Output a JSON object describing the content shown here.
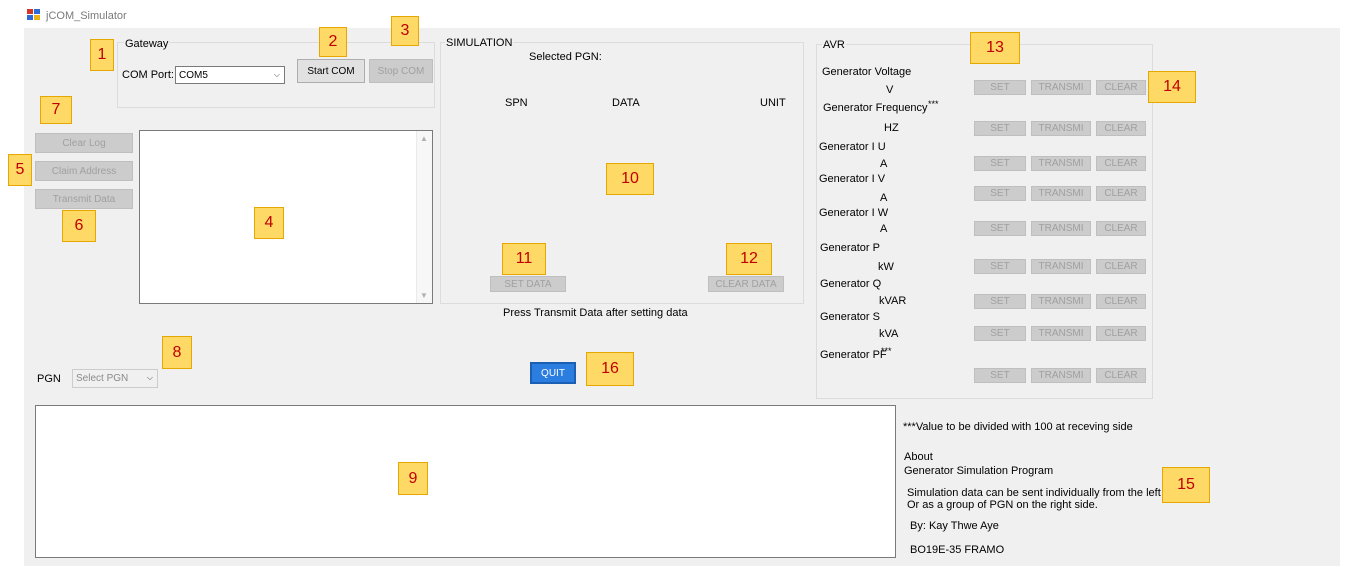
{
  "window": {
    "title": "jCOM_Simulator"
  },
  "gateway": {
    "group_label": "Gateway",
    "com_port_label": "COM Port:",
    "com_port_value": "COM5",
    "start_label": "Start COM",
    "stop_label": "Stop COM"
  },
  "left_buttons": {
    "clear_log": "Clear Log",
    "claim_address": "Claim Address",
    "transmit_data": "Transmit Data"
  },
  "pgn": {
    "label": "PGN",
    "placeholder": "Select PGN"
  },
  "simulation": {
    "group_label": "SIMULATION",
    "selected_pgn_label": "Selected PGN:",
    "col_spn": "SPN",
    "col_data": "DATA",
    "col_unit": "UNIT",
    "set_data": "SET DATA",
    "clear_data": "CLEAR DATA",
    "hint": "Press Transmit Data after setting data"
  },
  "quit_label": "QUIT",
  "avr": {
    "group_label": "AVR",
    "set_label": "SET",
    "transmit_label": "TRANSMI",
    "clear_label": "CLEAR",
    "rows": [
      {
        "name": "Generator Voltage",
        "unit": "V",
        "mark": ""
      },
      {
        "name": "Generator Frequency",
        "unit": "HZ",
        "mark": "***"
      },
      {
        "name": "Generator I U",
        "unit": "A",
        "mark": ""
      },
      {
        "name": "Generator I V",
        "unit": "A",
        "mark": ""
      },
      {
        "name": "Generator I W",
        "unit": "A",
        "mark": ""
      },
      {
        "name": "Generator P",
        "unit": "kW",
        "mark": ""
      },
      {
        "name": "Generator Q",
        "unit": "kVAR",
        "mark": ""
      },
      {
        "name": "Generator S",
        "unit": "kVA",
        "mark": ""
      },
      {
        "name": "Generator PF",
        "unit": "",
        "mark": "***"
      }
    ]
  },
  "info": {
    "note": "***Value to be divided with 100 at receving side",
    "about_title": "About",
    "about_program": "Generator Simulation Program",
    "about_line1": "Simulation data can be sent individually from the left side.",
    "about_line2": "Or as a group of PGN on the right side.",
    "author": "By: Kay Thwe Aye",
    "code": "BO19E-35 FRAMO"
  },
  "badges": [
    "1",
    "2",
    "3",
    "4",
    "5",
    "6",
    "7",
    "8",
    "9",
    "10",
    "11",
    "12",
    "13",
    "14",
    "15",
    "16"
  ],
  "colors": {
    "badge_bg": "#ffd966",
    "badge_text": "#c00000",
    "quit_bg": "#2b7de0"
  }
}
